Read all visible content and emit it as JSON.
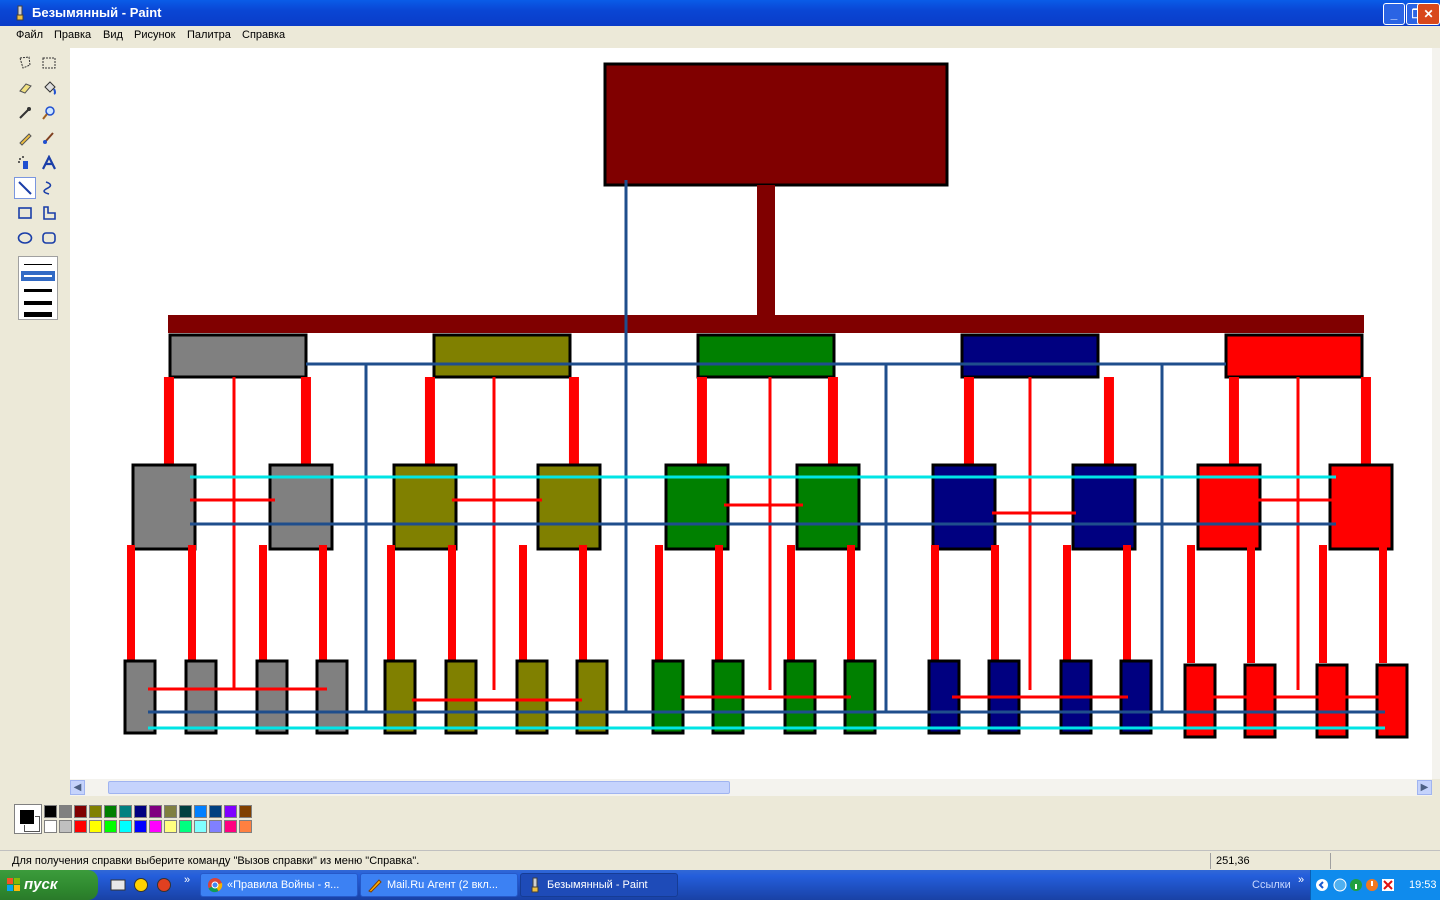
{
  "window": {
    "title": "Безымянный - Paint",
    "controls": {
      "minimize": "_",
      "maximize": "❐",
      "close": "✕"
    }
  },
  "menu": [
    "Файл",
    "Правка",
    "Вид",
    "Рисунок",
    "Палитра",
    "Справка"
  ],
  "toolbox": {
    "tools": [
      "free-select",
      "rect-select",
      "eraser",
      "fill",
      "picker",
      "magnifier",
      "pencil",
      "brush",
      "airbrush",
      "text",
      "line",
      "curve",
      "rectangle",
      "polygon",
      "ellipse",
      "rounded-rect"
    ],
    "selected_tool": "line"
  },
  "palette": {
    "foreground": "#000000",
    "background": "#ffffff",
    "row1": [
      "#000000",
      "#808080",
      "#800000",
      "#808000",
      "#008000",
      "#008080",
      "#000080",
      "#800080",
      "#808040",
      "#004040",
      "#0080ff",
      "#004080",
      "#8000ff",
      "#804000"
    ],
    "row2": [
      "#ffffff",
      "#c0c0c0",
      "#ff0000",
      "#ffff00",
      "#00ff00",
      "#00ffff",
      "#0000ff",
      "#ff00ff",
      "#ffff80",
      "#00ff80",
      "#80ffff",
      "#8080ff",
      "#ff0080",
      "#ff8040"
    ]
  },
  "status": {
    "help": "Для получения справки выберите команду \"Вызов справки\" из меню \"Справка\".",
    "coords": "251,36"
  },
  "taskbar": {
    "start": "пуск",
    "tasks": [
      {
        "label": "«Правила Войны - я...",
        "icon": "chrome-icon",
        "active": false
      },
      {
        "label": "Mail.Ru Агент (2 вкл...",
        "icon": "mail-agent-icon",
        "active": false
      },
      {
        "label": "Безымянный - Paint",
        "icon": "paint-icon",
        "active": true
      }
    ],
    "links": "Ссылки",
    "clock": "19:53"
  },
  "drawing": {
    "colors": {
      "top": "#800000",
      "bar": "#800000",
      "gray": "#808080",
      "olive": "#808000",
      "green": "#008000",
      "navy": "#000080",
      "red": "#ff0000",
      "connector": "#ff0000",
      "blue_line": "#1f4e8c",
      "cyan_line": "#00e5e5"
    }
  }
}
